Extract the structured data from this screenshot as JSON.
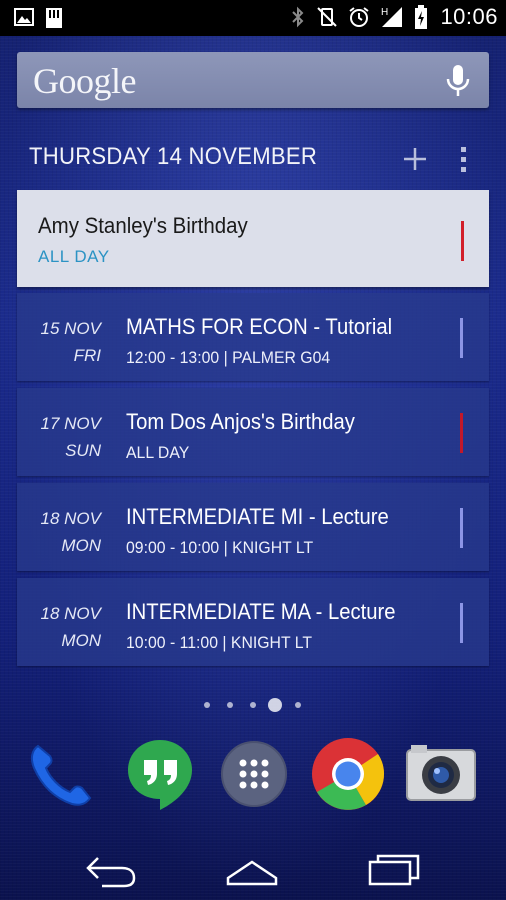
{
  "status_bar": {
    "time": "10:06",
    "left_icons": [
      "image-icon",
      "sd-card-icon"
    ],
    "right_icons": [
      "bluetooth-icon",
      "vibrate-off-icon",
      "alarm-icon",
      "signal-h-icon",
      "battery-icon"
    ],
    "network_label": "H"
  },
  "search": {
    "logo": "Google",
    "mic_icon": "mic-icon"
  },
  "calendar_widget": {
    "header_date": "THURSDAY 14 NOVEMBER",
    "add_icon": "plus-icon",
    "menu_icon": "overflow-menu-icon",
    "today_event": {
      "title": "Amy Stanley's Birthday",
      "subtitle": "ALL DAY",
      "color": "#d21f2a"
    },
    "events": [
      {
        "date": "15 NOV",
        "day": "FRI",
        "title": "MATHS FOR ECON - Tutorial",
        "subtitle": "12:00 - 13:00  |  PALMER G04",
        "color": "#8c95e6"
      },
      {
        "date": "17 NOV",
        "day": "SUN",
        "title": "Tom Dos Anjos's Birthday",
        "subtitle": "ALL DAY",
        "color": "#c2182a"
      },
      {
        "date": "18 NOV",
        "day": "MON",
        "title": "INTERMEDIATE MI - Lecture",
        "subtitle": "09:00 - 10:00  |  KNIGHT LT",
        "color": "#8c95e6"
      },
      {
        "date": "18 NOV",
        "day": "MON",
        "title": "INTERMEDIATE MA - Lecture",
        "subtitle": "10:00 - 11:00  |  KNIGHT LT",
        "color": "#8c95e6"
      }
    ]
  },
  "page_indicator": {
    "count": 5,
    "active_index": 3
  },
  "dock": {
    "apps": [
      "phone-icon",
      "hangouts-icon",
      "app-drawer-icon",
      "chrome-icon",
      "camera-icon"
    ]
  },
  "nav_bar": {
    "buttons": [
      "back-icon",
      "home-icon",
      "recents-icon"
    ]
  }
}
